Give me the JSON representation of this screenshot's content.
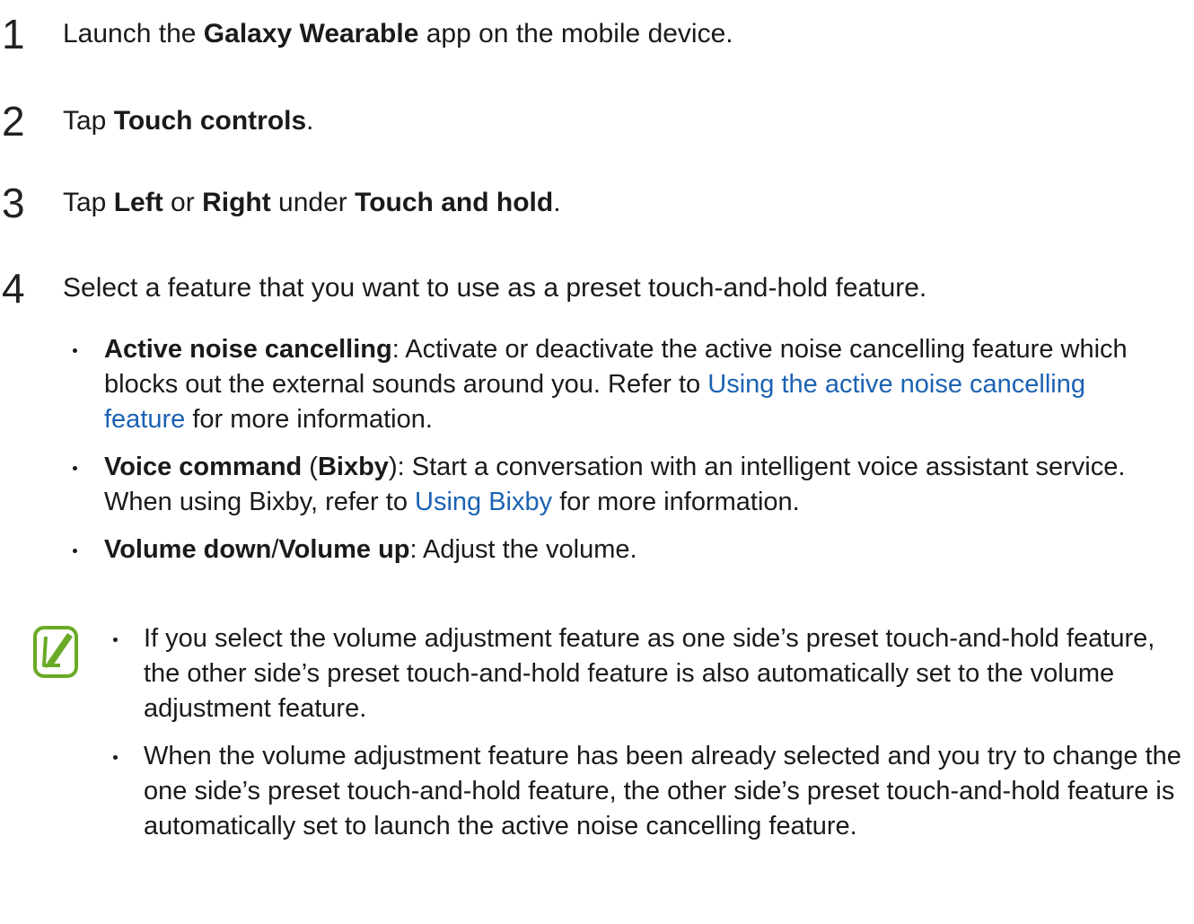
{
  "steps": [
    {
      "num": "1",
      "pre": "Launch the ",
      "bold": "Galaxy Wearable",
      "post": " app on the mobile device."
    },
    {
      "num": "2",
      "pre": "Tap ",
      "bold": "Touch controls",
      "post": "."
    },
    {
      "num": "3",
      "pre": "Tap ",
      "bold1": "Left",
      "mid1": " or ",
      "bold2": "Right",
      "mid2": " under ",
      "bold3": "Touch and hold",
      "post": "."
    },
    {
      "num": "4",
      "text": "Select a feature that you want to use as a preset touch-and-hold feature."
    }
  ],
  "bullets": [
    {
      "bold": "Active noise cancelling",
      "text": ": Activate or deactivate the active noise cancelling feature which blocks out the external sounds around you. Refer to ",
      "link": "Using the active noise cancelling feature",
      "post": " for more information."
    },
    {
      "bold1": "Voice command",
      "mid1": " (",
      "bold2": "Bixby",
      "text": "): Start a conversation with an intelligent voice assistant service. When using Bixby, refer to ",
      "link": "Using Bixby",
      "post": " for more information."
    },
    {
      "bold1": "Volume down",
      "mid1": "/",
      "bold2": "Volume up",
      "text": ": Adjust the volume."
    }
  ],
  "notes": [
    "If you select the volume adjustment feature as one side’s preset touch-and-hold feature, the other side’s preset touch-and-hold feature is also automatically set to the volume adjustment feature.",
    "When the volume adjustment feature has been already selected and you try to change the one side’s preset touch-and-hold feature, the other side’s preset touch-and-hold feature is automatically set to launch the active noise cancelling feature."
  ],
  "colors": {
    "link": "#1b62b3",
    "note_icon": "#6aaa26"
  },
  "icons": {
    "note": "note-pencil-icon"
  }
}
